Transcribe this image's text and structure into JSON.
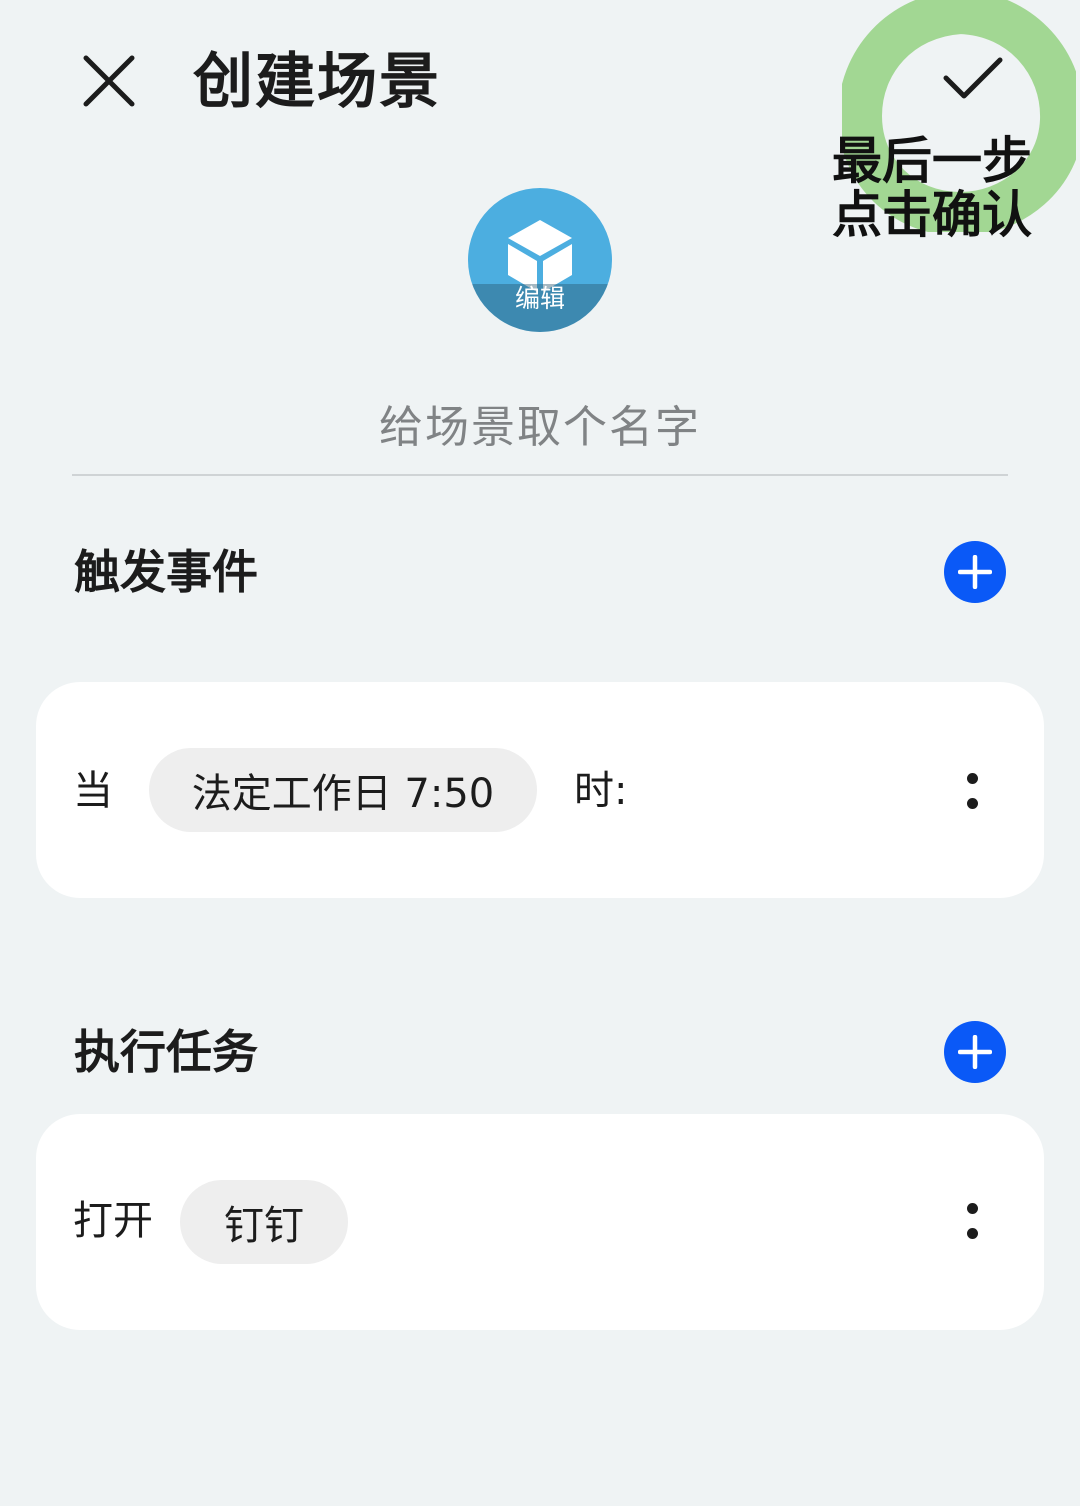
{
  "header": {
    "title": "创建场景",
    "close_icon": "close-icon",
    "confirm_icon": "checkmark-icon"
  },
  "annotation": {
    "line1": "最后一步",
    "line2": "点击确认"
  },
  "scene_icon": {
    "icon": "cube-icon",
    "edit_label": "编辑"
  },
  "name_field": {
    "placeholder": "给场景取个名字",
    "value": ""
  },
  "trigger_section": {
    "title": "触发事件",
    "add_icon": "plus-icon",
    "condition": {
      "prefix": "当",
      "chip": "法定工作日 7:50",
      "suffix": "时:"
    }
  },
  "task_section": {
    "title": "执行任务",
    "add_icon": "plus-icon",
    "task": {
      "prefix": "打开",
      "chip": "钉钉"
    }
  },
  "colors": {
    "background": "#eff3f4",
    "accent": "#0a59f7",
    "icon_bg": "#4caee0",
    "annotation_green": "#8fd07a"
  }
}
